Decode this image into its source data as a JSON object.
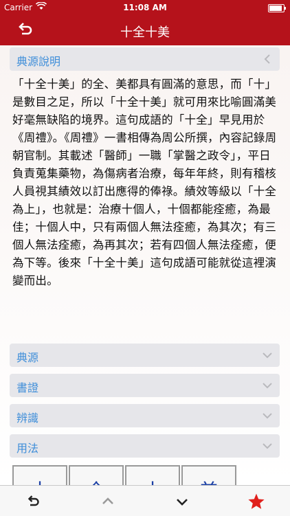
{
  "status_bar": {
    "carrier": "Carrier",
    "time": "11:08 AM"
  },
  "nav": {
    "title": "十全十美"
  },
  "sections": {
    "source_explanation": {
      "label": "典源說明"
    },
    "source": {
      "label": "典源"
    },
    "book_evidence": {
      "label": "書證"
    },
    "distinguish": {
      "label": "辨識"
    },
    "usage": {
      "label": "用法"
    }
  },
  "description": "「十全十美」的全、美都具有圓滿的意思，而「十」是數目之足，所以「十全十美」就可用來比喻圓滿美好毫無缺陷的境界。這句成語的「十全」早見用於《周禮》。《周禮》一書相傳為周公所撰，內容記錄周朝官制。其載述「醫師」一職「掌醫之政令」，平日負責蒐集藥物，為傷病者治療，每年年終，則有稽核人員視其績效以訂出應得的俸祿。績效等級以「十全為上」，也就是：治療十個人，十個都能痊癒，為最佳；十個人中，只有兩個人無法痊癒，為其次；有三個人無法痊癒，為再其次；若有四個人無法痊癒，便為下等。後來「十全十美」這句成語可能就從這裡演變而出。",
  "char_boxes": [
    "十",
    "全",
    "十",
    "美"
  ],
  "toolbar": {
    "icons": [
      "undo-icon",
      "chevron-up-icon",
      "chevron-down-icon",
      "star-icon"
    ],
    "accent": "#e0201c"
  },
  "colors": {
    "brand": "#b5121b",
    "section_label": "#3f8ed9"
  }
}
